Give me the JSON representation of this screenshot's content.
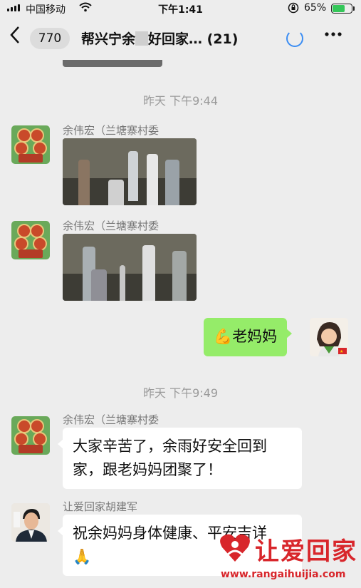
{
  "status_bar": {
    "carrier": "中国移动",
    "time": "下午1:41",
    "battery_percent": "65%",
    "battery_level": 0.65,
    "icons": [
      "signal-icon",
      "wifi-icon",
      "orientation-lock-icon",
      "battery-icon"
    ]
  },
  "nav": {
    "back_icon": "chevron-left-icon",
    "unread_count": "770",
    "title_part1": "帮兴宁余",
    "title_part2": "好回家…",
    "member_count": "(21)",
    "more_icon": "more-dots-icon"
  },
  "messages": [
    {
      "type": "timestamp",
      "text": "昨天 下午9:44"
    },
    {
      "type": "image",
      "side": "left",
      "sender": "余伟宏（兰塘寨村委"
    },
    {
      "type": "image",
      "side": "left",
      "sender": "余伟宏（兰塘寨村委"
    },
    {
      "type": "text",
      "side": "right",
      "emoji": "💪",
      "text": "老妈妈"
    },
    {
      "type": "timestamp",
      "text": "昨天 下午9:49"
    },
    {
      "type": "text",
      "side": "left",
      "sender": "余伟宏（兰塘寨村委",
      "lines": [
        "大家辛苦了，余雨好安全回到",
        "家，跟老妈妈团聚了！"
      ]
    },
    {
      "type": "text",
      "side": "left",
      "sender": "让爱回家胡建军",
      "lines": [
        "祝余妈妈身体健康、平安吉详",
        "🙏"
      ]
    }
  ],
  "watermark": {
    "text": "让爱回家",
    "url": "www.rangaihuijia.com"
  },
  "colors": {
    "background": "#ededed",
    "outgoing_bubble": "#95ec69",
    "incoming_bubble": "#ffffff",
    "watermark": "#d8262b"
  }
}
